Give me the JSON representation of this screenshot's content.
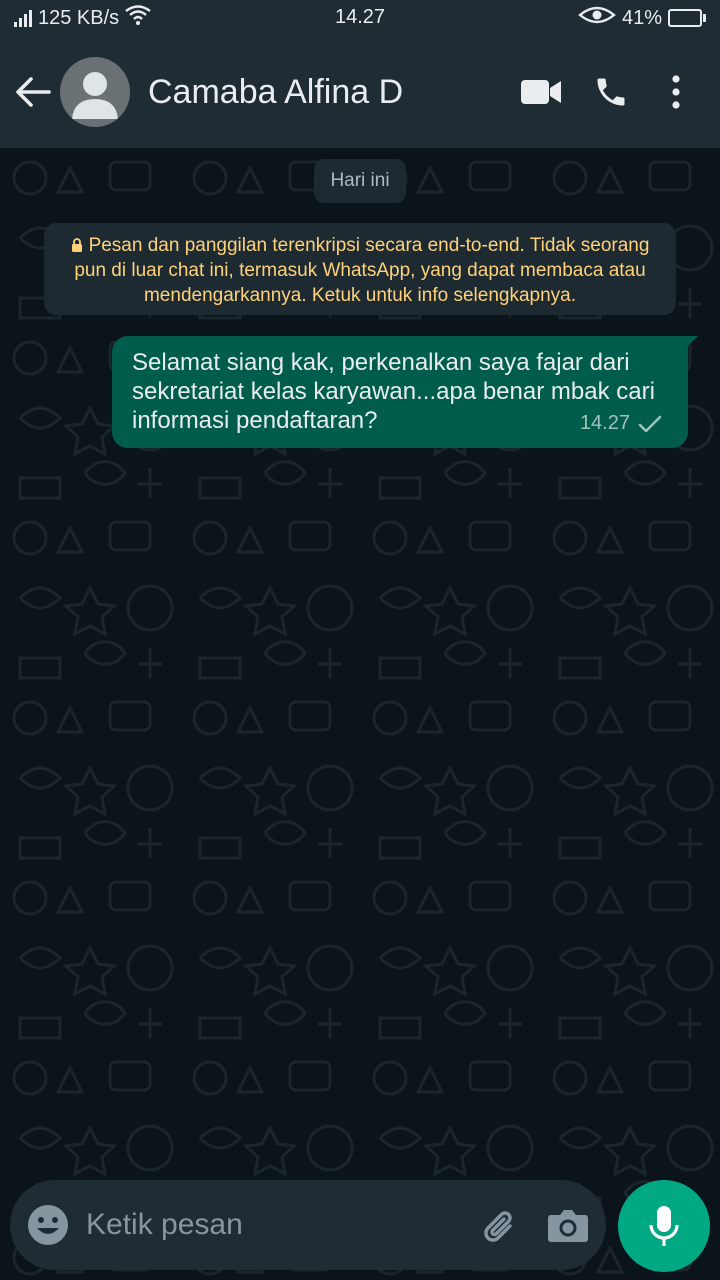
{
  "status_bar": {
    "network_speed": "125 KB/s",
    "time": "14.27",
    "battery_percent": "41%",
    "battery_level": 0.41,
    "icons": [
      "signal-icon",
      "wifi-icon",
      "eye-icon",
      "battery-icon"
    ]
  },
  "header": {
    "contact_name": "Camaba Alfina D",
    "icons": [
      "back-arrow-icon",
      "avatar-icon",
      "video-call-icon",
      "phone-call-icon",
      "more-vertical-icon"
    ]
  },
  "chat": {
    "date_divider": "Hari ini",
    "encryption_notice": "Pesan dan panggilan terenkripsi secara end-to-end. Tidak seorang pun di luar chat ini, termasuk WhatsApp, yang dapat membaca atau mendengarkannya. Ketuk untuk info selengkapnya.",
    "messages": [
      {
        "direction": "outgoing",
        "text": "Selamat siang kak, perkenalkan saya fajar dari sekretariat kelas karyawan...apa benar mbak cari informasi pendaftaran?",
        "time": "14.27",
        "status": "sent"
      }
    ]
  },
  "composer": {
    "placeholder": "Ketik pesan",
    "value": "",
    "icons": [
      "emoji-icon",
      "attach-icon",
      "camera-icon",
      "mic-icon"
    ]
  },
  "colors": {
    "header_bg": "#1f2c34",
    "chat_bg": "#0b141a",
    "outgoing_bubble": "#005c4b",
    "system_bubble": "#1d2a31",
    "encryption_text": "#ffd279",
    "accent": "#00a884"
  }
}
